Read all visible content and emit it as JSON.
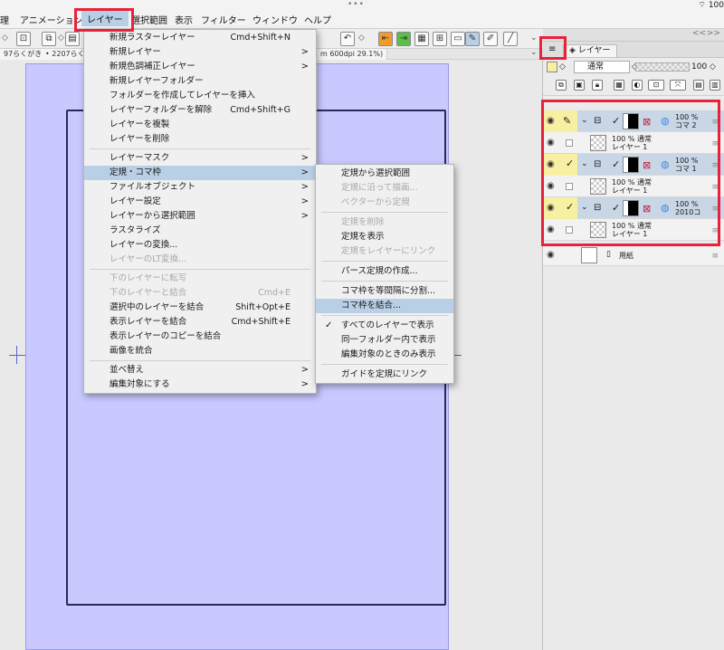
{
  "menubar": {
    "items": [
      "理",
      "アニメーション",
      "レイヤー",
      "選択範囲",
      "表示",
      "フィルター",
      "ウィンドウ",
      "ヘルプ"
    ],
    "status_right": "100"
  },
  "tabs": {
    "tab1": "97らくがき",
    "tab2": "2207らく",
    "tab3": "m 600dpi 29.1%)"
  },
  "layer_menu": {
    "items": [
      {
        "label": "新規ラスターレイヤー",
        "shortcut": "Cmd+Shift+N",
        "arrow": false,
        "disabled": false
      },
      {
        "label": "新規レイヤー",
        "shortcut": "",
        "arrow": true,
        "disabled": false
      },
      {
        "label": "新規色調補正レイヤー",
        "shortcut": "",
        "arrow": true,
        "disabled": false
      },
      {
        "label": "新規レイヤーフォルダー",
        "shortcut": "",
        "arrow": false,
        "disabled": false
      },
      {
        "label": "フォルダーを作成してレイヤーを挿入",
        "shortcut": "",
        "arrow": false,
        "disabled": false
      },
      {
        "label": "レイヤーフォルダーを解除",
        "shortcut": "Cmd+Shift+G",
        "arrow": false,
        "disabled": false
      },
      {
        "label": "レイヤーを複製",
        "shortcut": "",
        "arrow": false,
        "disabled": false
      },
      {
        "label": "レイヤーを削除",
        "shortcut": "",
        "arrow": false,
        "disabled": false
      },
      {
        "label": "レイヤーマスク",
        "shortcut": "",
        "arrow": true,
        "disabled": false
      },
      {
        "label": "定規・コマ枠",
        "shortcut": "",
        "arrow": true,
        "disabled": false
      },
      {
        "label": "ファイルオブジェクト",
        "shortcut": "",
        "arrow": true,
        "disabled": false
      },
      {
        "label": "レイヤー設定",
        "shortcut": "",
        "arrow": true,
        "disabled": false
      },
      {
        "label": "レイヤーから選択範囲",
        "shortcut": "",
        "arrow": true,
        "disabled": false
      },
      {
        "label": "ラスタライズ",
        "shortcut": "",
        "arrow": false,
        "disabled": false
      },
      {
        "label": "レイヤーの変換...",
        "shortcut": "",
        "arrow": false,
        "disabled": false
      },
      {
        "label": "レイヤーのLT変換...",
        "shortcut": "",
        "arrow": false,
        "disabled": true
      },
      {
        "label": "下のレイヤーに転写",
        "shortcut": "",
        "arrow": false,
        "disabled": true
      },
      {
        "label": "下のレイヤーと結合",
        "shortcut": "Cmd+E",
        "arrow": false,
        "disabled": true
      },
      {
        "label": "選択中のレイヤーを結合",
        "shortcut": "Shift+Opt+E",
        "arrow": false,
        "disabled": false
      },
      {
        "label": "表示レイヤーを結合",
        "shortcut": "Cmd+Shift+E",
        "arrow": false,
        "disabled": false
      },
      {
        "label": "表示レイヤーのコピーを結合",
        "shortcut": "",
        "arrow": false,
        "disabled": false
      },
      {
        "label": "画像を統合",
        "shortcut": "",
        "arrow": false,
        "disabled": false
      },
      {
        "label": "並べ替え",
        "shortcut": "",
        "arrow": true,
        "disabled": false
      },
      {
        "label": "編集対象にする",
        "shortcut": "",
        "arrow": true,
        "disabled": false
      }
    ]
  },
  "ruler_submenu": {
    "items": [
      {
        "label": "定規から選択範囲",
        "disabled": false,
        "checked": false
      },
      {
        "label": "定規に沿って描画...",
        "disabled": true,
        "checked": false
      },
      {
        "label": "ベクターから定規",
        "disabled": true,
        "checked": false
      },
      {
        "label": "定規を削除",
        "disabled": true,
        "checked": false
      },
      {
        "label": "定規を表示",
        "disabled": false,
        "checked": false
      },
      {
        "label": "定規をレイヤーにリンク",
        "disabled": true,
        "checked": false
      },
      {
        "label": "パース定規の作成...",
        "disabled": false,
        "checked": false
      },
      {
        "label": "コマ枠を等間隔に分割...",
        "disabled": false,
        "checked": false
      },
      {
        "label": "コマ枠を結合...",
        "disabled": false,
        "checked": false
      },
      {
        "label": "すべてのレイヤーで表示",
        "disabled": false,
        "checked": true
      },
      {
        "label": "同一フォルダー内で表示",
        "disabled": false,
        "checked": false
      },
      {
        "label": "編集対象のときのみ表示",
        "disabled": false,
        "checked": false
      },
      {
        "label": "ガイドを定規にリンク",
        "disabled": false,
        "checked": false
      }
    ]
  },
  "layer_panel": {
    "tab_label": "レイヤー",
    "blend_mode": "通常",
    "opacity": "100",
    "layers": [
      {
        "pct": "100 %",
        "name": "コマ 2",
        "sub": "100 % 通常",
        "child": "レイヤー 1"
      },
      {
        "pct": "100 %",
        "name": "コマ 1",
        "sub": "100 % 通常",
        "child": "レイヤー 1"
      },
      {
        "pct": "100 %",
        "name": "2010コ",
        "sub": "100 % 通常",
        "child": "レイヤー 1"
      }
    ],
    "paper_label": "用紙"
  },
  "colors": {
    "highlight": "#b9cfe6",
    "accent_red": "#e8223a",
    "canvas_paper": "#c9c9ff"
  }
}
